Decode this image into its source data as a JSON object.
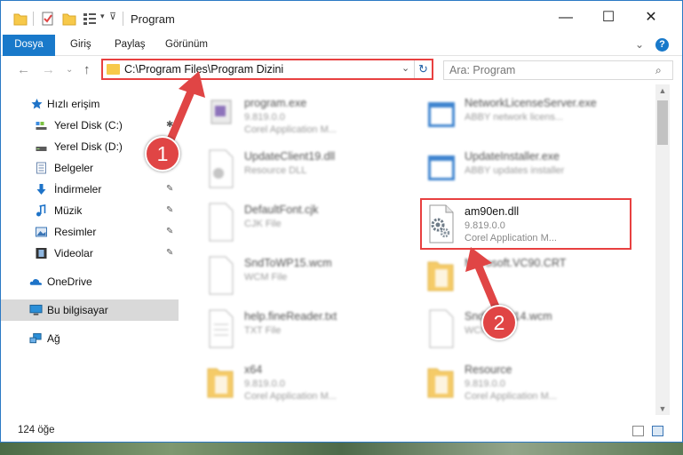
{
  "window": {
    "title": "Program",
    "controls": {
      "minimize": "—",
      "maximize": "☐",
      "close": "✕"
    }
  },
  "ribbon": {
    "tabs": [
      "Dosya",
      "Giriş",
      "Paylaş",
      "Görünüm"
    ],
    "help": "?"
  },
  "address": {
    "path": "C:\\Program Files\\Program Dizini",
    "search_placeholder": "Ara: Program"
  },
  "sidebar": {
    "items": [
      {
        "label": "Hızlı erişim",
        "icon": "star-icon",
        "color": "#1e73c8",
        "pinned": false
      },
      {
        "label": "Yerel Disk (C:)",
        "icon": "drive-c-icon",
        "color": "#5b5b5b",
        "pinned": true
      },
      {
        "label": "Yerel Disk (D:)",
        "icon": "drive-d-icon",
        "color": "#5b5b5b",
        "pinned": true
      },
      {
        "label": "Belgeler",
        "icon": "documents-icon",
        "color": "#6c89b0",
        "pinned": true
      },
      {
        "label": "İndirmeler",
        "icon": "downloads-icon",
        "color": "#1e73c8",
        "pinned": true
      },
      {
        "label": "Müzik",
        "icon": "music-icon",
        "color": "#1e73c8",
        "pinned": true
      },
      {
        "label": "Resimler",
        "icon": "pictures-icon",
        "color": "#3a75b5",
        "pinned": true
      },
      {
        "label": "Videolar",
        "icon": "videos-icon",
        "color": "#333333",
        "pinned": true
      },
      {
        "label": "OneDrive",
        "icon": "onedrive-icon",
        "color": "#1e73c8",
        "pinned": false
      },
      {
        "label": "Bu bilgisayar",
        "icon": "this-pc-icon",
        "color": "#2b8fd8",
        "pinned": false,
        "selected": true
      },
      {
        "label": "Ağ",
        "icon": "network-icon",
        "color": "#2b8fd8",
        "pinned": false
      }
    ],
    "pin_glyph": "📌"
  },
  "files": {
    "left": [
      {
        "name": "program.exe",
        "line2": "9.819.0.0",
        "line3": "Corel Application M...",
        "icon": "exe-icon"
      },
      {
        "name": "UpdateClient19.dll",
        "line2": "Resource DLL",
        "line3": "",
        "icon": "dll-icon"
      },
      {
        "name": "DefaultFont.cjk",
        "line2": "CJK File",
        "line3": "",
        "icon": "file-icon"
      },
      {
        "name": "SndToWP15.wcm",
        "line2": "WCM File",
        "line3": "",
        "icon": "file-icon"
      },
      {
        "name": "help.fineReader.txt",
        "line2": "TXT File",
        "line3": "",
        "icon": "text-file-icon"
      },
      {
        "name": "x64",
        "line2": "9.819.0.0",
        "line3": "Corel Application M...",
        "icon": "folder-icon"
      }
    ],
    "right": [
      {
        "name": "NetworkLicenseServer.exe",
        "line2": "ABBY network licens...",
        "line3": "",
        "icon": "app-window-icon"
      },
      {
        "name": "UpdateInstaller.exe",
        "line2": "ABBY updates installer",
        "line3": "",
        "icon": "app-window-icon"
      },
      {
        "name": "am90en.dll",
        "line2": "9.819.0.0",
        "line3": "Corel Application M...",
        "icon": "dll-gear-icon",
        "highlighted": true
      },
      {
        "name": "Microsoft.VC90.CRT",
        "line2": "",
        "line3": "",
        "icon": "folder-icon"
      },
      {
        "name": "SndToWP14.wcm",
        "line2": "WCM File",
        "line3": "",
        "icon": "file-icon"
      },
      {
        "name": "Resource",
        "line2": "9.819.0.0",
        "line3": "Corel Application M...",
        "icon": "folder-icon"
      }
    ]
  },
  "status": {
    "count": "124 öğe"
  },
  "callouts": {
    "one": "1",
    "two": "2",
    "color": "#e04545"
  }
}
